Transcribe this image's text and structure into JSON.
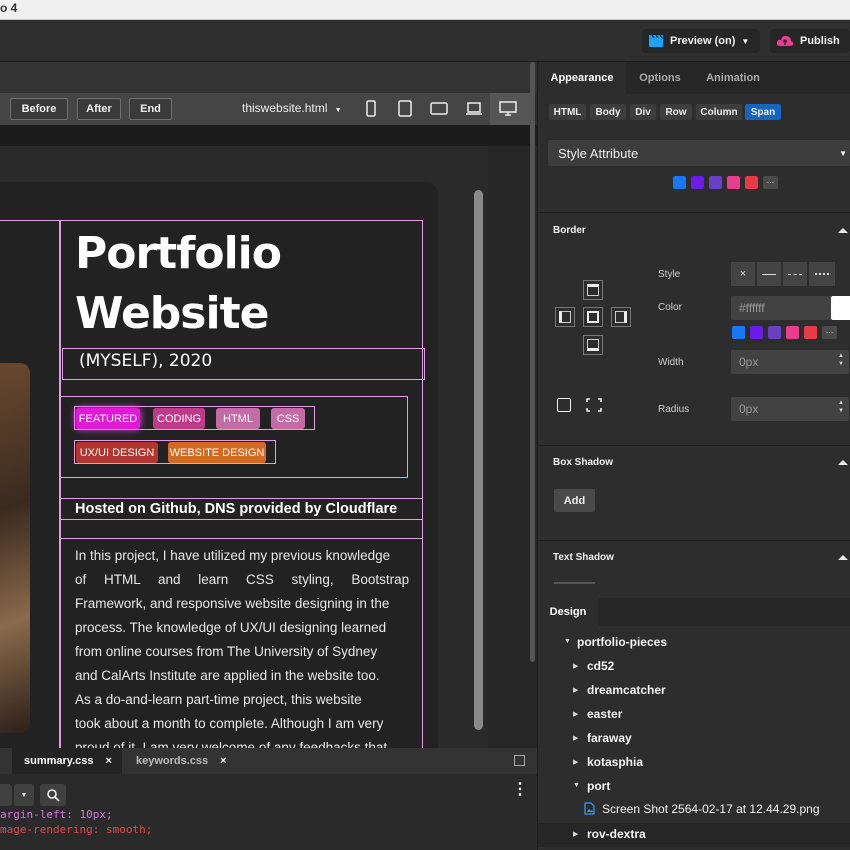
{
  "window": {
    "title_fragment": "o 4"
  },
  "topbar": {
    "preview_label": "Preview (on)",
    "publish_label": "Publish"
  },
  "toolbar": {
    "buttons": [
      "Before",
      "After",
      "End"
    ],
    "file_name": "thiswebsite.html"
  },
  "preview": {
    "title": "Portfolio Website",
    "subtitle": "(MYSELF), 2020",
    "tags_row1": [
      "FEATURED",
      "CODING",
      "HTML",
      "CSS"
    ],
    "tags_row2": [
      "UX/UI DESIGN",
      "WEBSITE DESIGN"
    ],
    "hosted": "Hosted on Github, DNS provided by Cloudflare",
    "body_lines": [
      "In this project, I have utilized my previous knowledge",
      "of HTML and learn CSS styling, Bootstrap",
      "Framework, and responsive website designing in the",
      "process. The knowledge of UX/UI designing learned",
      "from online courses from The University of Sydney",
      "and CalArts Institute are applied in the website too.",
      "As a do-and-learn part-time project, this website",
      "took about a month to complete. Although I am very",
      "proud of it, I am very welcome of any feedbacks that"
    ]
  },
  "editor": {
    "tabs": [
      "summary.css",
      "keywords.css"
    ],
    "code_lines": [
      "argin-left: 10px;",
      "mage-rendering: smooth;"
    ]
  },
  "right_panel": {
    "tabs": [
      "Appearance",
      "Options",
      "Animation"
    ],
    "element_buttons": [
      "HTML",
      "Body",
      "Div",
      "Row",
      "Column",
      "Span"
    ],
    "dropdown": "Style Attribute",
    "border": {
      "title": "Border",
      "style_label": "Style",
      "color_label": "Color",
      "color_value": "#ffffff",
      "width_label": "Width",
      "width_value": "0px",
      "radius_label": "Radius",
      "radius_value": "0px"
    },
    "box_shadow": {
      "title": "Box Shadow",
      "add_label": "Add"
    },
    "text_shadow": {
      "title": "Text Shadow"
    },
    "swatches": [
      "#1877f2",
      "#6c1be8",
      "#6a3fc1",
      "#e83e8c",
      "#e83a47"
    ]
  },
  "design_panel": {
    "tab": "Design",
    "root": "portfolio-pieces",
    "folders": [
      "cd52",
      "dreamcatcher",
      "easter",
      "faraway",
      "kotasphia",
      "port"
    ],
    "file": "Screen Shot 2564-02-17 at 12.44.29.png",
    "last_folder": "rov-dextra"
  }
}
